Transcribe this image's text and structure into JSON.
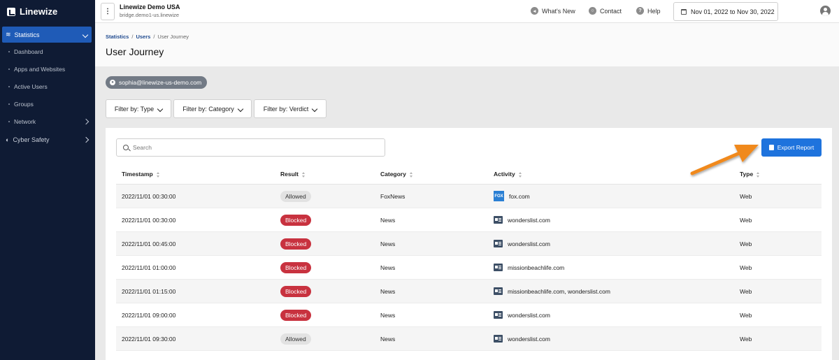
{
  "sidebar": {
    "logo": "Linewize",
    "statistics": "Statistics",
    "sub_items": [
      "Dashboard",
      "Apps and Websites",
      "Active Users",
      "Groups",
      "Network"
    ],
    "cyber_safety": "Cyber Safety"
  },
  "topbar": {
    "org_name": "Linewize Demo USA",
    "org_host": "bridge.demo1-us.linewize",
    "whats_new": "What's New",
    "contact": "Contact",
    "help": "Help",
    "date_range": "Nov 01, 2022 to Nov 30, 2022"
  },
  "breadcrumb": {
    "statistics": "Statistics",
    "users": "Users",
    "current": "User Journey",
    "sep": "/"
  },
  "page_title": "User Journey",
  "user_chip": "sophia@linewize-us-demo.com",
  "filters": {
    "type": "Filter by: Type",
    "category": "Filter by: Category",
    "verdict": "Filter by: Verdict"
  },
  "search": {
    "placeholder": "Search"
  },
  "export_label": "Export Report",
  "table": {
    "headers": {
      "timestamp": "Timestamp",
      "result": "Result",
      "category": "Category",
      "activity": "Activity",
      "type": "Type"
    },
    "rows": [
      {
        "timestamp": "2022/11/01 00:30:00",
        "result": "Allowed",
        "category": "FoxNews",
        "activity": "fox.com",
        "icon": "fox-icon",
        "type": "Web"
      },
      {
        "timestamp": "2022/11/01 00:30:00",
        "result": "Blocked",
        "category": "News",
        "activity": "wonderslist.com",
        "icon": "news-icon",
        "type": "Web"
      },
      {
        "timestamp": "2022/11/01 00:45:00",
        "result": "Blocked",
        "category": "News",
        "activity": "wonderslist.com",
        "icon": "news-icon",
        "type": "Web"
      },
      {
        "timestamp": "2022/11/01 01:00:00",
        "result": "Blocked",
        "category": "News",
        "activity": "missionbeachlife.com",
        "icon": "news-icon",
        "type": "Web"
      },
      {
        "timestamp": "2022/11/01 01:15:00",
        "result": "Blocked",
        "category": "News",
        "activity": "missionbeachlife.com, wonderslist.com",
        "icon": "news-icon",
        "type": "Web"
      },
      {
        "timestamp": "2022/11/01 09:00:00",
        "result": "Blocked",
        "category": "News",
        "activity": "wonderslist.com",
        "icon": "news-icon",
        "type": "Web"
      },
      {
        "timestamp": "2022/11/01 09:30:00",
        "result": "Allowed",
        "category": "News",
        "activity": "wonderslist.com",
        "icon": "news-icon",
        "type": "Web"
      }
    ]
  },
  "colors": {
    "sidebar_bg": "#0f1b34",
    "accent": "#1e73dd",
    "blocked": "#c8323f",
    "arrow": "#f0891e"
  }
}
